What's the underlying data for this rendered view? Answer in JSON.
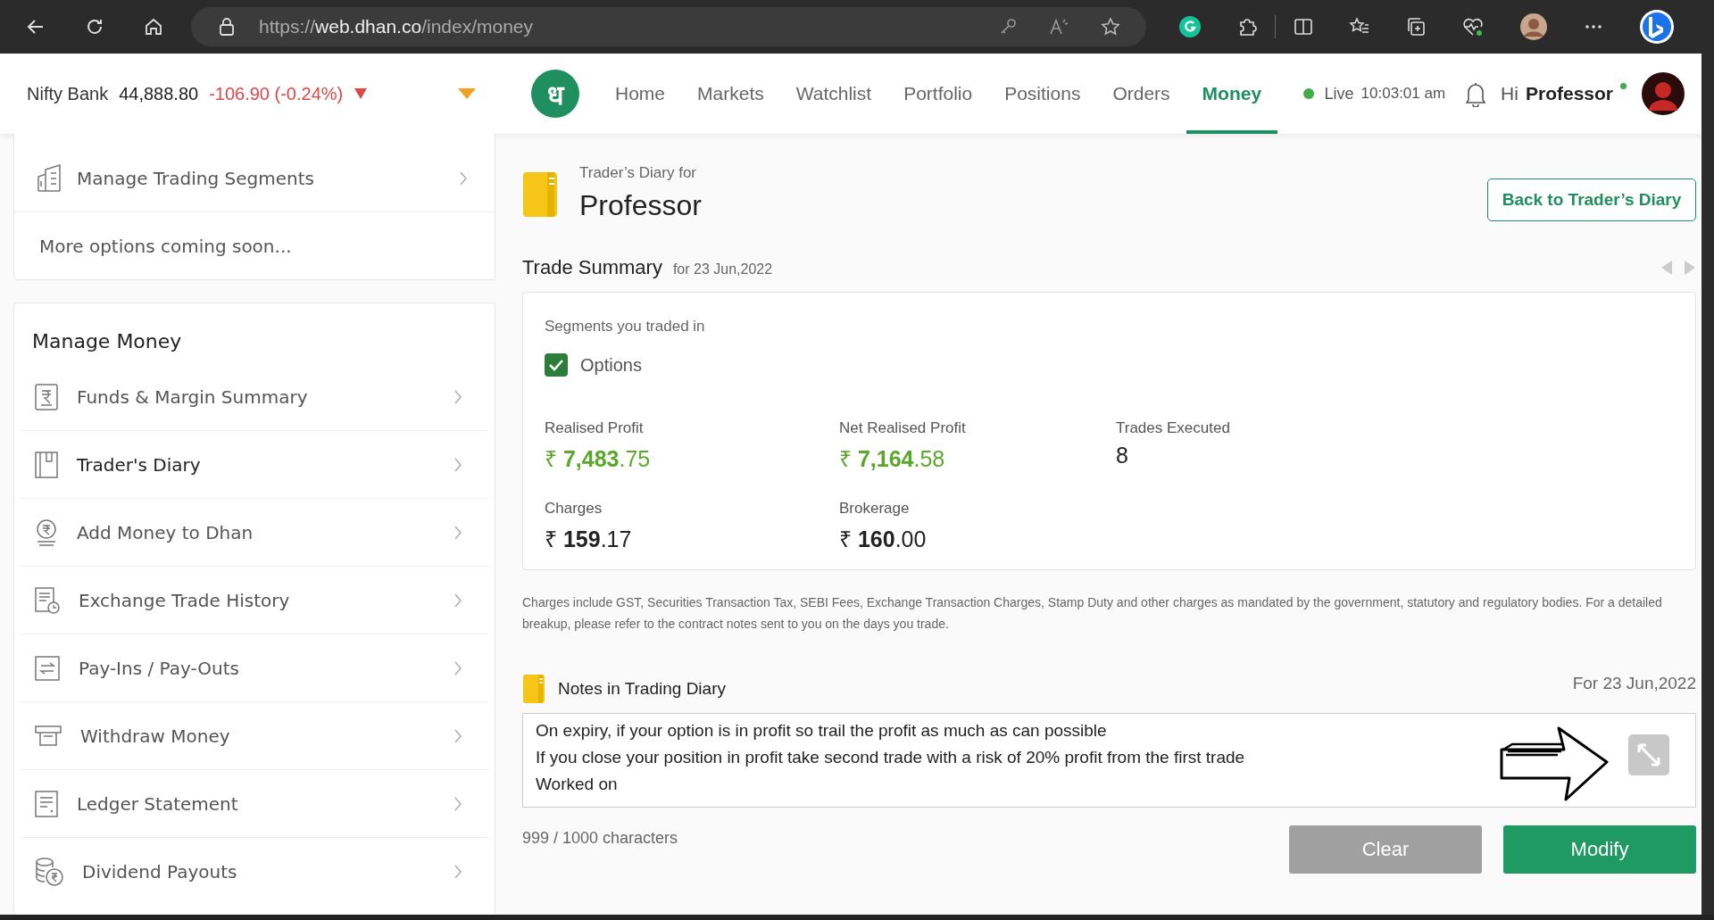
{
  "browser": {
    "url_scheme": "https://",
    "url_host": "web.dhan.co",
    "url_path": "/index/money"
  },
  "header": {
    "ticker": {
      "name": "Nifty Bank",
      "value": "44,888.80",
      "change": "-106.90 (-0.24%)",
      "falling": true
    },
    "logo": "ध",
    "nav": [
      {
        "label": "Home",
        "selected": false
      },
      {
        "label": "Markets",
        "selected": false
      },
      {
        "label": "Watchlist",
        "selected": false
      },
      {
        "label": "Portfolio",
        "selected": false
      },
      {
        "label": "Positions",
        "selected": false
      },
      {
        "label": "Orders",
        "selected": false
      },
      {
        "label": "Money",
        "selected": true
      }
    ],
    "live_label": "Live",
    "time": "10:03:01 am",
    "greeting": "Hi",
    "user": "Professor",
    "online": true
  },
  "sidebar": {
    "top_items": [
      {
        "label": "Manage Trading Segments"
      }
    ],
    "top_note": "More options coming soon...",
    "section_title": "Manage Money",
    "items": [
      {
        "label": "Funds & Margin Summary",
        "selected": false
      },
      {
        "label": "Trader's Diary",
        "selected": true
      },
      {
        "label": "Add Money to Dhan",
        "selected": false
      },
      {
        "label": "Exchange Trade History",
        "selected": false
      },
      {
        "label": "Pay-Ins / Pay-Outs",
        "selected": false
      },
      {
        "label": "Withdraw Money",
        "selected": false
      },
      {
        "label": "Ledger Statement",
        "selected": false
      },
      {
        "label": "Dividend Payouts",
        "selected": false
      }
    ]
  },
  "main": {
    "subtitle": "Trader’s Diary for",
    "title": "Professor",
    "back_button": "Back to Trader’s Diary",
    "summary_title": "Trade Summary",
    "summary_date": "for 23 Jun,2022",
    "segments_label": "Segments you traded in",
    "segments": [
      {
        "label": "Options",
        "checked": true
      }
    ],
    "stats": [
      {
        "label": "Realised Profit",
        "value": "₹ **7,483**.75",
        "positive": true
      },
      {
        "label": "Net Realised Profit",
        "value": "₹ **7,164**.58",
        "positive": true
      },
      {
        "label": "Trades Executed",
        "value": "8",
        "positive": false
      },
      {
        "label": "Charges",
        "value": "₹ **159**.17",
        "positive": false
      },
      {
        "label": "Brokerage",
        "value": "₹ **160**.00",
        "positive": false
      }
    ],
    "footnote": "Charges include GST, Securities Transaction Tax, SEBI Fees, Exchange Transaction Charges, Stamp Duty and other charges as mandated by the government, statutory and regulatory bodies. For a detailed breakup, please refer to the contract notes sent to you on the days you trade.",
    "notes_title": "Notes in Trading Diary",
    "notes_date": "For 23 Jun,2022",
    "notes": "On expiry, if your option is in profit so trail the profit as much as can possible\nIf you close your position in profit take second trade with a risk of 20% profit from the first trade\nWorked on",
    "char_count": "999 / 1000 characters",
    "clear_button": "Clear",
    "modify_button": "Modify"
  }
}
